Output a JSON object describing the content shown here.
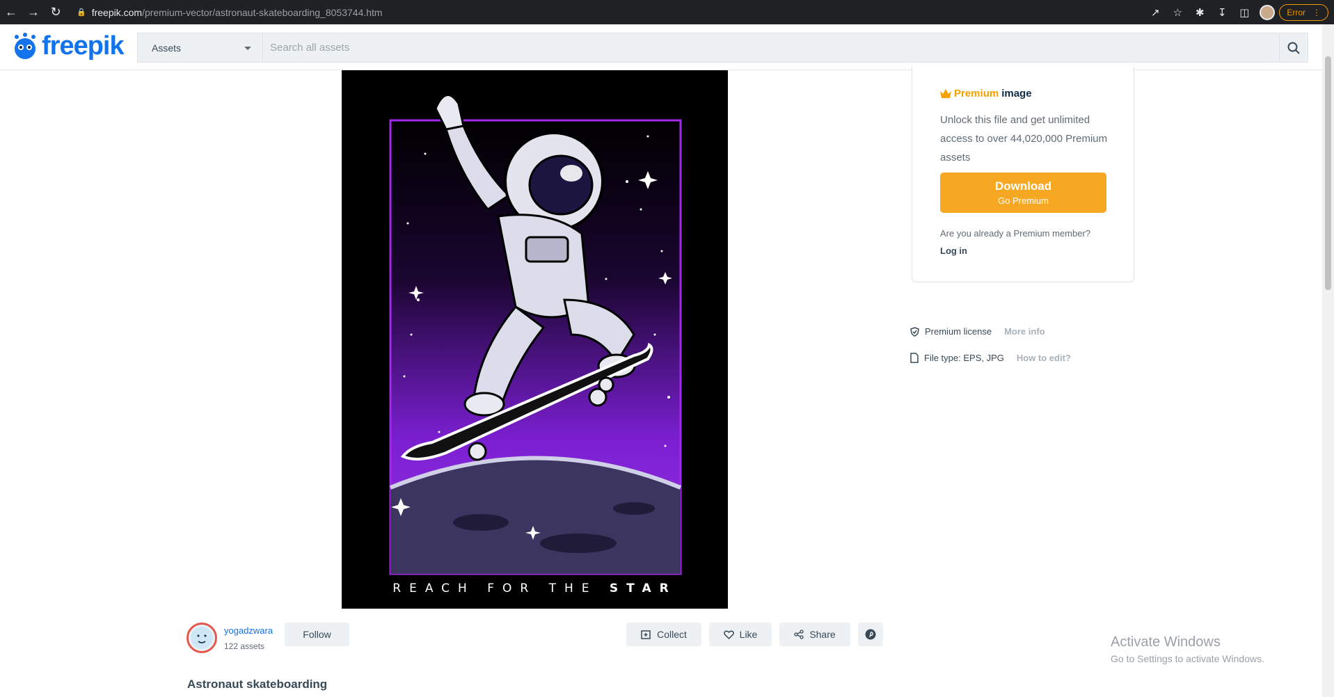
{
  "browser": {
    "url_host": "freepik.com",
    "url_path": "/premium-vector/astronaut-skateboarding_8053744.htm",
    "error_label": "Error"
  },
  "header": {
    "logo_text": "freepik",
    "assets_select": "Assets",
    "search_placeholder": "Search all assets"
  },
  "preview": {
    "caption_regular": "REACH FOR THE ",
    "caption_bold": "STAR"
  },
  "premium_card": {
    "title_gold": "Premium",
    "title_rest": "image",
    "description": "Unlock this file and get unlimited access to over 44,020,000 Premium assets",
    "download_label": "Download",
    "download_sub": "Go Premium",
    "member_question": "Are you already a Premium member?",
    "login_label": "Log in"
  },
  "license": {
    "label": "Premium license",
    "link": "More info"
  },
  "filetype": {
    "label": "File type: EPS, JPG",
    "link": "How to edit?"
  },
  "author": {
    "name": "yogadzwara",
    "assets": "122 assets",
    "follow_label": "Follow"
  },
  "actions": {
    "collect": "Collect",
    "like": "Like",
    "share": "Share"
  },
  "page_title": "Astronaut skateboarding",
  "windows_watermark": {
    "line1": "Activate Windows",
    "line2": "Go to Settings to activate Windows."
  },
  "colors": {
    "brand_blue": "#1273eb",
    "premium_orange": "#f7a823",
    "purple": "#8a2be2"
  }
}
